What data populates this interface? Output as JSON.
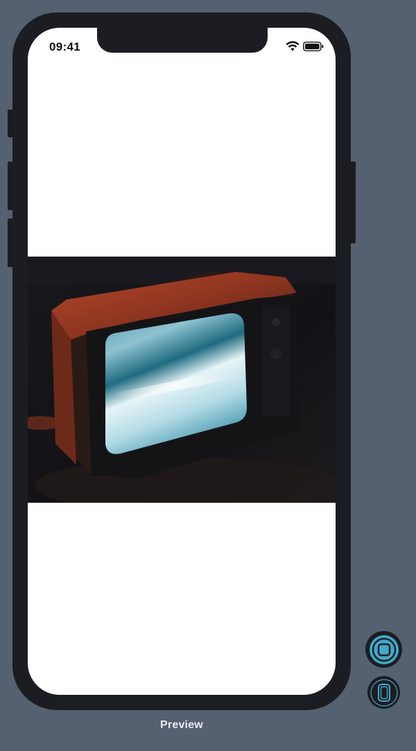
{
  "status_bar": {
    "time": "09:41",
    "wifi_icon": "wifi-icon",
    "battery_icon": "battery-icon"
  },
  "content": {
    "image": "retro-tv-photo"
  },
  "controls": {
    "home_button_icon": "home-button-icon",
    "device_button_icon": "device-icon"
  },
  "footer": {
    "label": "Preview"
  },
  "colors": {
    "background": "#556070",
    "device_frame": "#1c1d22",
    "accent": "#3fa9c9"
  }
}
